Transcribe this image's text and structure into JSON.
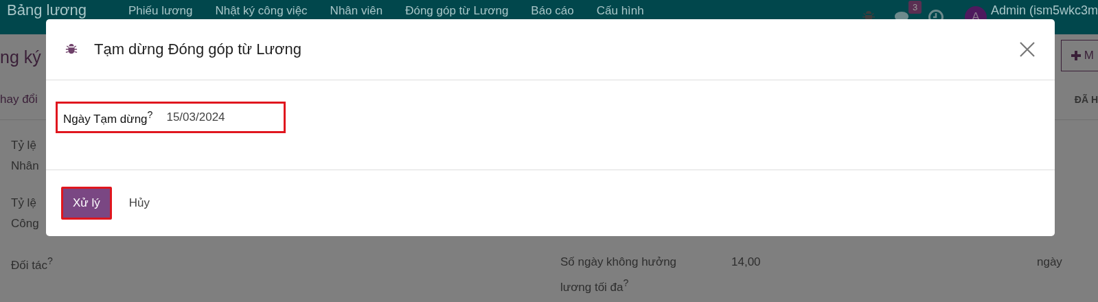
{
  "navbar": {
    "brand": "Bảng lương",
    "menu": [
      "Phiếu lương",
      "Nhật ký công việc",
      "Nhân viên",
      "Đóng góp từ Lương",
      "Báo cáo",
      "Cấu hình"
    ],
    "message_count": "3",
    "avatar": "A",
    "user": "Admin (ism5wkc3m"
  },
  "control_panel": {
    "breadcrumb": "ng ký",
    "new_button": "M"
  },
  "status_row": {
    "left": "hay đổi",
    "right": "ĐÃ H"
  },
  "form": {
    "left_fields": [
      {
        "lines": [
          "Tỷ lệ",
          "Nhân"
        ]
      },
      {
        "lines": [
          "Tỷ lệ",
          "Công"
        ]
      },
      {
        "lines": [
          "Đối tác$^{?}$"
        ]
      }
    ],
    "right_field": {
      "label": "Số ngày không hưởng lương tối đa$^{?}$",
      "value": "14,00",
      "unit": "ngày"
    }
  },
  "dialog": {
    "title": "Tạm dừng Đóng góp từ Lương",
    "field": {
      "label": "Ngày Tạm dừng$^{?}$",
      "value": "15/03/2024",
      "highlighted": true
    },
    "buttons": [
      {
        "label": "Xử lý",
        "kind": "primary",
        "highlighted": true
      },
      {
        "label": "Hủy",
        "kind": "secondary",
        "highlighted": false
      }
    ]
  }
}
